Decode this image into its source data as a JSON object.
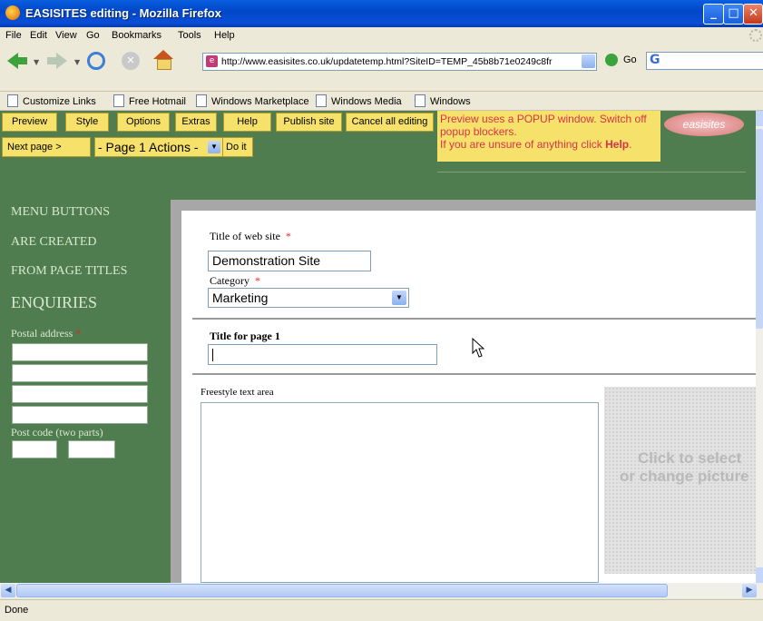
{
  "window": {
    "title": "EASISITES editing - Mozilla Firefox"
  },
  "menu": [
    "File",
    "Edit",
    "View",
    "Go",
    "Bookmarks",
    "Tools",
    "Help"
  ],
  "navigation": {
    "url": "http://www.easisites.co.uk/updatetemp.html?SiteID=TEMP_45b8b71e0249c8fr",
    "go_label": "Go"
  },
  "links": [
    "Customize Links",
    "Free Hotmail",
    "Windows Marketplace",
    "Windows Media",
    "Windows"
  ],
  "editor_toolbar": {
    "buttons": [
      "Preview",
      "Style",
      "Options",
      "Extras",
      "Help",
      "Publish site",
      "Cancel all editing"
    ],
    "next_page": "Next page >",
    "page_actions": "- Page 1 Actions -",
    "do_it": "Do it",
    "note_line1": "Preview uses a POPUP window. Switch off popup blockers.",
    "note_line2a": "If you are unsure of anything click ",
    "note_line2b": "Help",
    "note_line2c": ".",
    "logo": "easisites"
  },
  "sidebar": {
    "menu_buttons": "MENU BUTTONS",
    "are_created": "ARE CREATED",
    "from_titles": "FROM PAGE TITLES",
    "enquiries": "ENQUIRIES",
    "postal_label": "Postal address",
    "postcode_label": "Post code (two parts)"
  },
  "form": {
    "site_title_label": "Title of web site",
    "site_title_value": "Demonstration Site",
    "category_label": "Category",
    "category_value": "Marketing",
    "page_title_label": "Title for page 1",
    "freestyle_label": "Freestyle text area",
    "picture_line1": "Click to select",
    "picture_line2": "or change picture",
    "required_mark": "*"
  },
  "status": {
    "text": "Done"
  }
}
